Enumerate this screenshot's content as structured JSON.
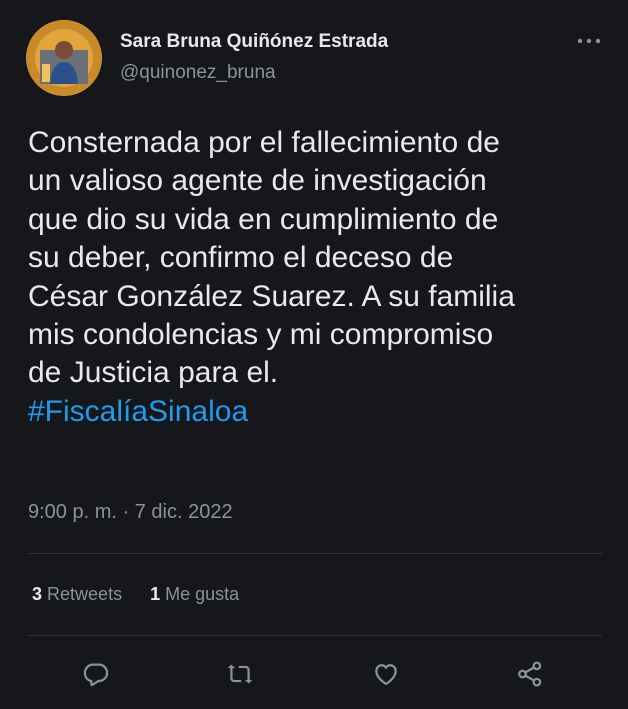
{
  "author": {
    "display_name": "Sara Bruna Quiñónez Estrada",
    "handle": "@quinonez_bruna"
  },
  "tweet": {
    "lines": [
      "Consternada por el fallecimiento de",
      "un valioso agente de investigación",
      "que dio su vida en cumplimiento de",
      "su deber, confirmo  el deceso de",
      "César González Suarez. A su familia",
      "mis condolencias y mi compromiso",
      "de Justicia para el."
    ],
    "hashtag": "#FiscalíaSinaloa",
    "timestamp": "9:00 p. m. · 7 dic. 2022"
  },
  "stats": {
    "retweets_count": "3",
    "retweets_label": "Retweets",
    "likes_count": "1",
    "likes_label": "Me gusta"
  },
  "icons": {
    "more": "more-horizontal-icon",
    "reply": "reply-icon",
    "retweet": "retweet-icon",
    "like": "heart-icon",
    "share": "share-icon"
  },
  "colors": {
    "background": "#15171b",
    "text": "#e7e9ea",
    "secondary": "#8b9298",
    "accent": "#1d9bf0",
    "divider": "#2f3336"
  }
}
